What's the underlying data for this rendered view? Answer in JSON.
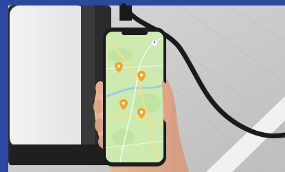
{
  "colors": {
    "border_blue": "#2a48a0",
    "map_green": "#cdeab0",
    "road_yellow": "#f3e08a",
    "river_blue": "#9ecbe8",
    "pin_orange": "#f0a630",
    "cable_black": "#1a1a1a",
    "ground_grey": "#c8c8c6"
  },
  "scene": {
    "subject": "hand-holding-smartphone",
    "background": "ev-charging-station",
    "pins": [
      {
        "icon": "map-pin-icon"
      },
      {
        "icon": "map-pin-icon"
      },
      {
        "icon": "map-pin-icon"
      },
      {
        "icon": "map-pin-icon"
      }
    ],
    "compass_icon": "compass-icon"
  }
}
